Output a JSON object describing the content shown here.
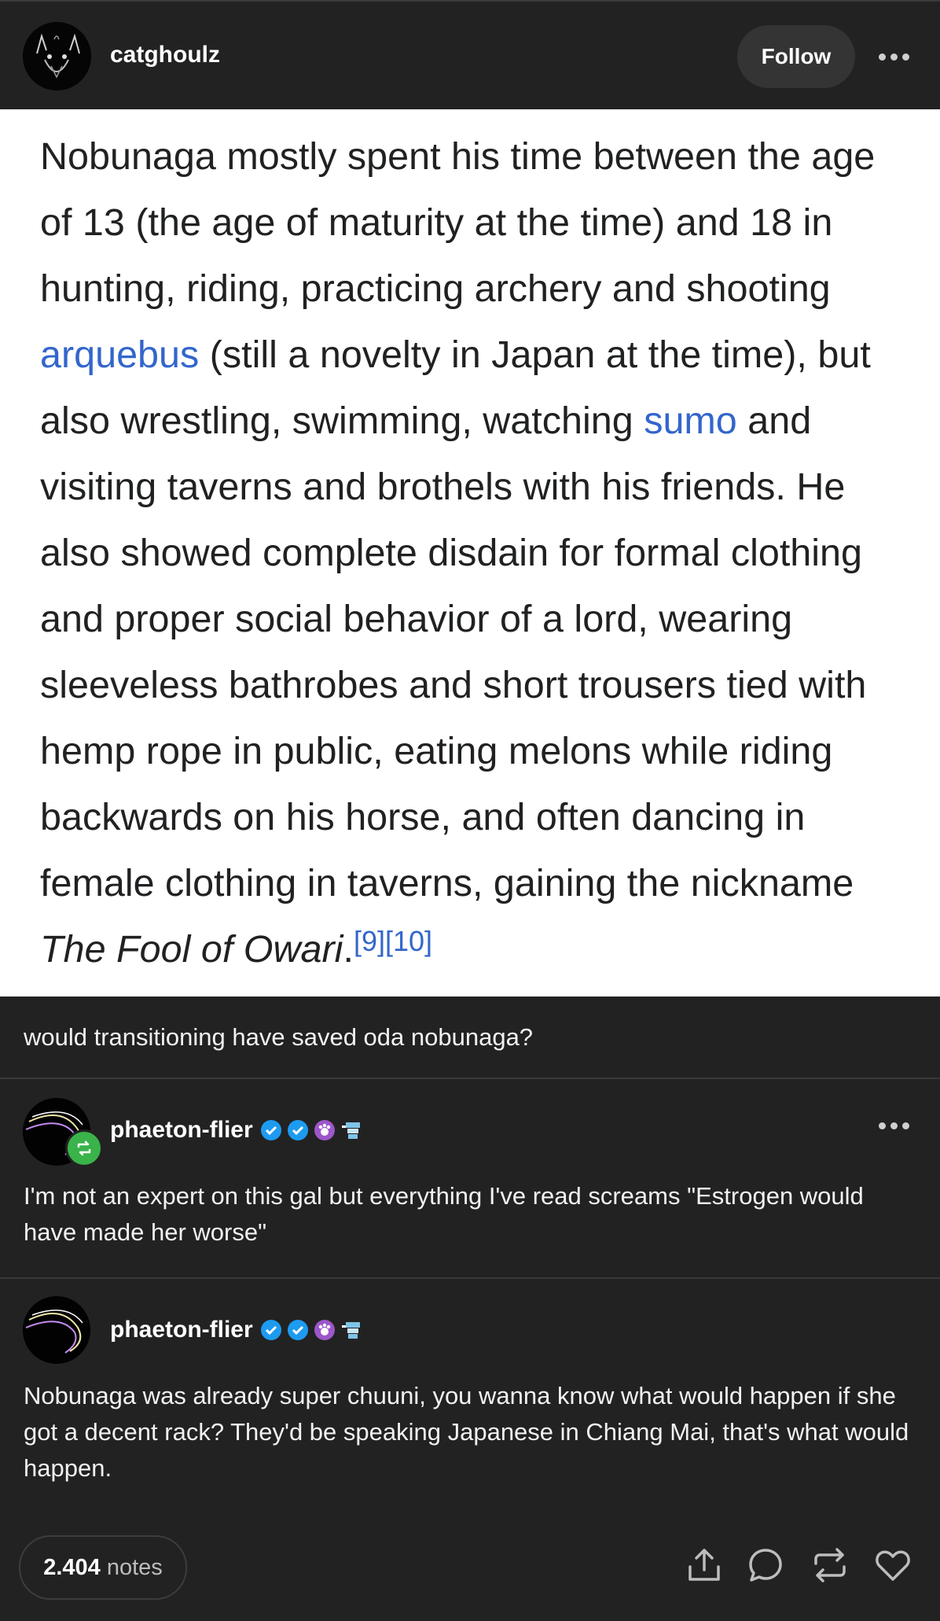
{
  "post": {
    "author": "catghoulz",
    "follow_label": "Follow",
    "menu_icon": "more-dots-icon"
  },
  "quote": {
    "p1": "Nobunaga mostly spent his time between the age of 13 (the age of maturity at the time) and 18 in hunting, riding, practicing archery and shooting ",
    "link1": "arquebus",
    "p2": " (still a novelty in Japan at the time), but also wrestling, swimming, watching ",
    "link2": "sumo",
    "p3": " and visiting taverns and brothels with his friends. He also showed complete disdain for formal clothing and proper social behavior of a lord, wearing sleeveless bathrobes and short trousers tied with hemp rope in public, eating melons while riding backwards on his horse, and often dancing in female clothing in taverns, gaining the nickname ",
    "italic": "The Fool of Owari",
    "p4": ".",
    "refs": "[9][10]"
  },
  "caption": "would transitioning have saved oda nobunaga?",
  "reblogs": [
    {
      "author": "phaeton-flier",
      "text": "I'm not an expert on this gal but everything I've read screams \"Estrogen would have made her worse\""
    },
    {
      "author": "phaeton-flier",
      "text": "Nobunaga was already super chuuni, you wanna know what would happen if she got a decent rack? They'd be speaking Japanese in Chiang Mai, that's what would happen."
    }
  ],
  "footer": {
    "notes_count": "2.404",
    "notes_label": "notes",
    "icons": [
      "share-icon",
      "reply-icon",
      "reblog-icon",
      "like-icon"
    ]
  },
  "colors": {
    "background": "#222222",
    "link": "#3366cc",
    "verified": "#1d9bf0",
    "reblog_badge": "#3ab34a"
  }
}
